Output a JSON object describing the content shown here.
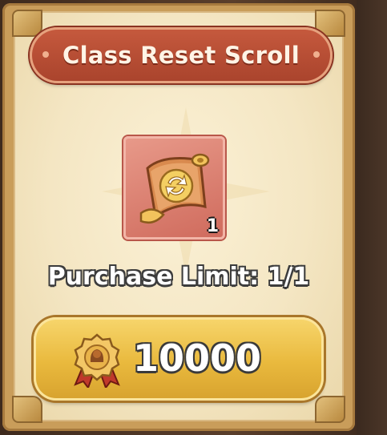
{
  "item": {
    "title": "Class Reset Scroll",
    "icon": "scroll-icon",
    "count": "1"
  },
  "purchase": {
    "limit_label": "Purchase Limit: 1/1",
    "price": "10000",
    "currency_icon": "medal-icon"
  },
  "colors": {
    "banner": "#b34a32",
    "item_frame": "#d9786a",
    "button": "#eec04e"
  }
}
